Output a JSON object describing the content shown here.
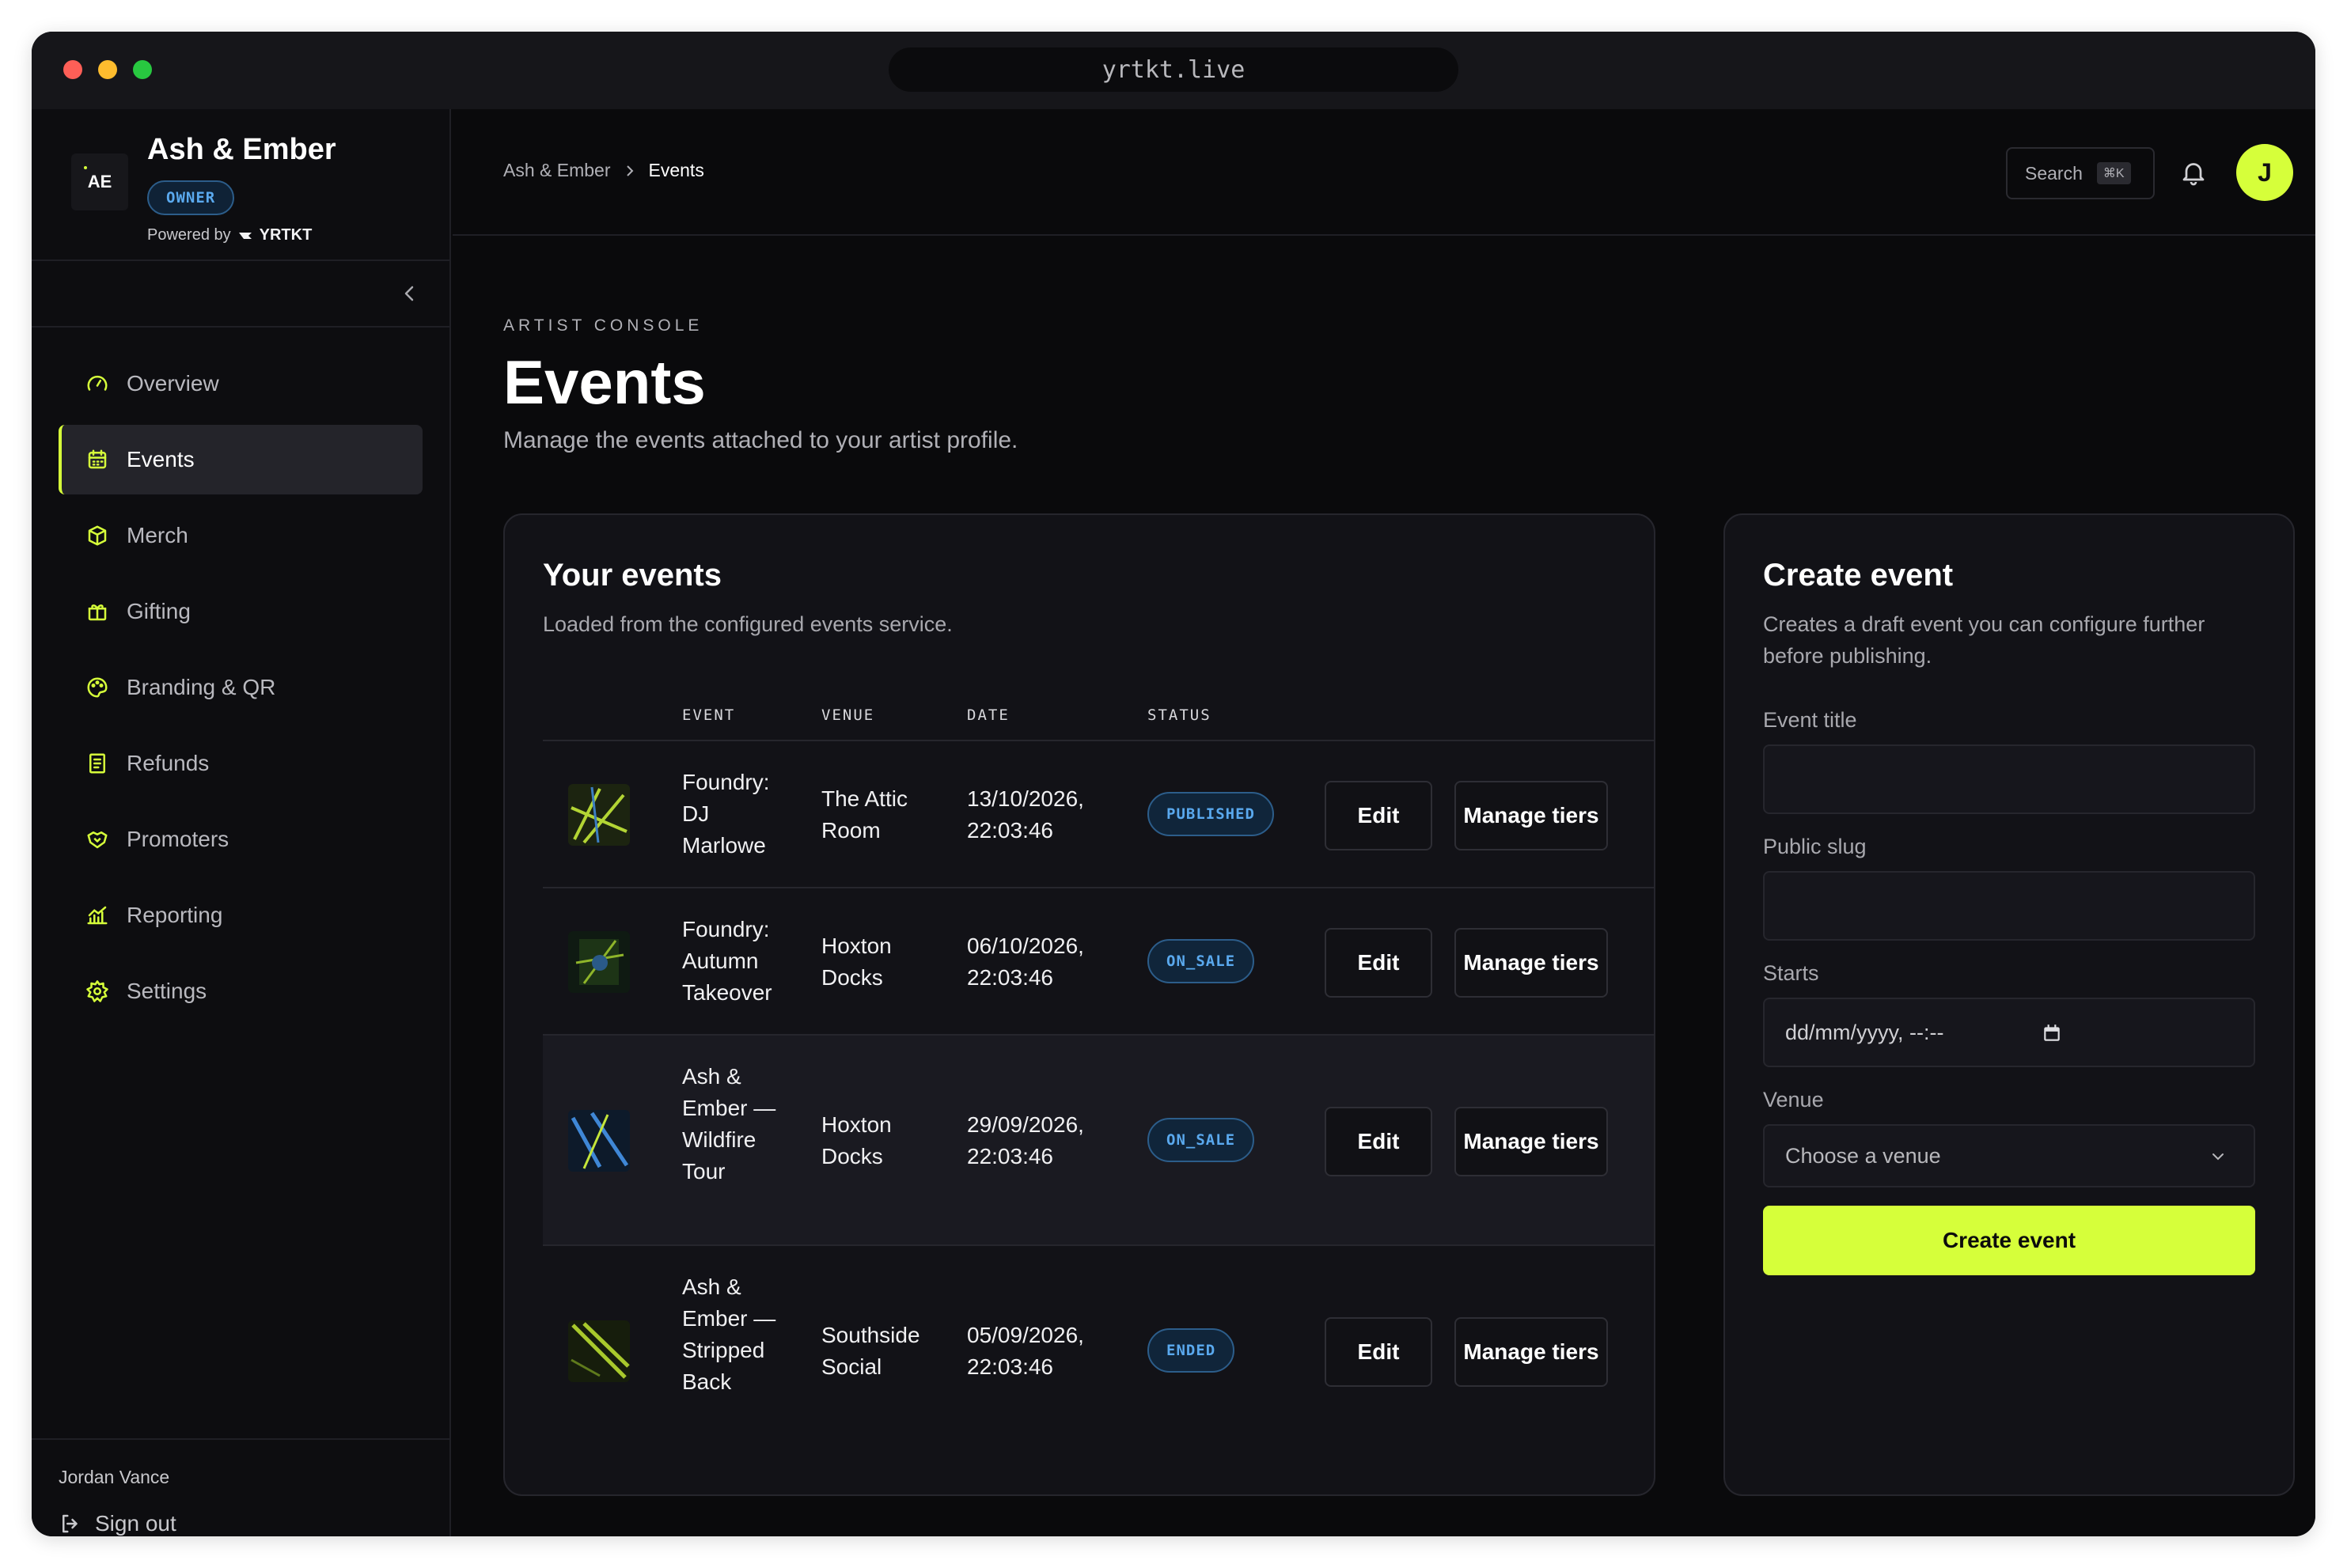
{
  "browser": {
    "url": "yrtkt.live"
  },
  "brand": {
    "logo_text": "AE",
    "name": "Ash & Ember",
    "role_badge": "OWNER",
    "powered_by": "Powered by",
    "powered_brand": "YRTKT"
  },
  "sidebar": {
    "items": [
      {
        "label": "Overview",
        "icon": "gauge-icon",
        "active": false
      },
      {
        "label": "Events",
        "icon": "calendar-icon",
        "active": true
      },
      {
        "label": "Merch",
        "icon": "box-icon",
        "active": false
      },
      {
        "label": "Gifting",
        "icon": "gift-icon",
        "active": false
      },
      {
        "label": "Branding & QR",
        "icon": "palette-icon",
        "active": false
      },
      {
        "label": "Refunds",
        "icon": "receipt-icon",
        "active": false
      },
      {
        "label": "Promoters",
        "icon": "handshake-icon",
        "active": false
      },
      {
        "label": "Reporting",
        "icon": "bar-chart-icon",
        "active": false
      },
      {
        "label": "Settings",
        "icon": "gear-icon",
        "active": false
      }
    ],
    "user_name": "Jordan Vance",
    "sign_out": "Sign out"
  },
  "topbar": {
    "breadcrumb": [
      "Ash & Ember",
      "Events"
    ],
    "search_label": "Search",
    "search_shortcut": "⌘K",
    "avatar_initial": "J"
  },
  "page": {
    "eyebrow": "ARTIST CONSOLE",
    "title": "Events",
    "subtitle": "Manage the events attached to your artist profile."
  },
  "events_card": {
    "title": "Your events",
    "subtitle": "Loaded from the configured events service.",
    "columns": [
      "EVENT",
      "VENUE",
      "DATE",
      "STATUS"
    ],
    "edit_label": "Edit",
    "manage_label": "Manage tiers",
    "rows": [
      {
        "event": "Foundry: DJ Marlowe",
        "venue": "The Attic Room",
        "date": "13/10/2026, 22:03:46",
        "status": "PUBLISHED"
      },
      {
        "event": "Foundry: Autumn Takeover",
        "venue": "Hoxton Docks",
        "date": "06/10/2026, 22:03:46",
        "status": "ON_SALE"
      },
      {
        "event": "Ash & Ember — Wildfire Tour",
        "venue": "Hoxton Docks",
        "date": "29/09/2026, 22:03:46",
        "status": "ON_SALE"
      },
      {
        "event": "Ash & Ember — Stripped Back",
        "venue": "Southside Social",
        "date": "05/09/2026, 22:03:46",
        "status": "ENDED"
      }
    ]
  },
  "create_card": {
    "title": "Create event",
    "subtitle": "Creates a draft event you can configure further before publishing.",
    "title_label": "Event title",
    "title_value": "",
    "slug_label": "Public slug",
    "slug_value": "",
    "starts_label": "Starts",
    "starts_placeholder": "dd/mm/yyyy, --:--",
    "venue_label": "Venue",
    "venue_selected": "Choose a venue",
    "submit_label": "Create event"
  },
  "colors": {
    "accent": "#d6ff3a",
    "status_blue": "#5aa9ee"
  }
}
